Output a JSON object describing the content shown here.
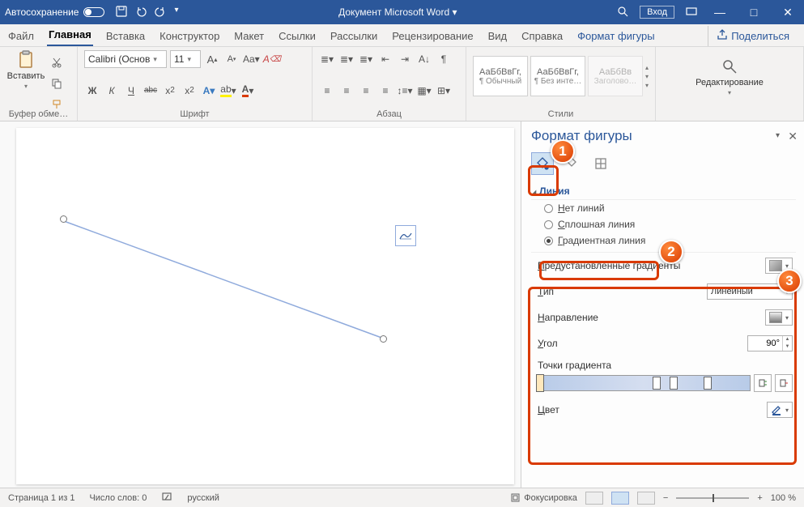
{
  "titlebar": {
    "autosave": "Автосохранение",
    "title": "Документ Microsoft Word ▾",
    "login": "Вход"
  },
  "tabs": {
    "file": "Файл",
    "home": "Главная",
    "insert": "Вставка",
    "design": "Конструктор",
    "layout": "Макет",
    "references": "Ссылки",
    "mail": "Рассылки",
    "review": "Рецензирование",
    "view": "Вид",
    "help": "Справка",
    "format": "Формат фигуры",
    "share": "Поделиться"
  },
  "ribbon": {
    "clipboard": {
      "label": "Буфер обме…",
      "paste": "Вставить"
    },
    "font": {
      "label": "Шрифт",
      "family": "Calibri (Основ",
      "size": "11",
      "b": "Ж",
      "i": "К",
      "u": "Ч",
      "s": "abc"
    },
    "paragraph": {
      "label": "Абзац"
    },
    "styles": {
      "label": "Стили",
      "s1_sample": "АаБбВвГг,",
      "s1_name": "¶ Обычный",
      "s2_sample": "АаБбВвГг,",
      "s2_name": "¶ Без инте…",
      "s3_sample": "АаБбВв",
      "s3_name": "Заголово…"
    },
    "editing": {
      "label": "Редактирование"
    }
  },
  "panel": {
    "title": "Формат фигуры",
    "section": "Линия",
    "r_none": "Нет линий",
    "r_solid": "Сплошная линия",
    "r_grad": "Градиентная линия",
    "preset": "Предустановленные градиенты",
    "type": "Тип",
    "type_val": "Линейный",
    "direction": "Направление",
    "angle": "Угол",
    "angle_val": "90°",
    "stops": "Точки градиента",
    "color": "Цвет"
  },
  "callouts": {
    "one": "1",
    "two": "2",
    "three": "3"
  },
  "status": {
    "page": "Страница 1 из 1",
    "words": "Число слов: 0",
    "lang": "русский",
    "focus": "Фокусировка",
    "zoom": "100 %"
  }
}
